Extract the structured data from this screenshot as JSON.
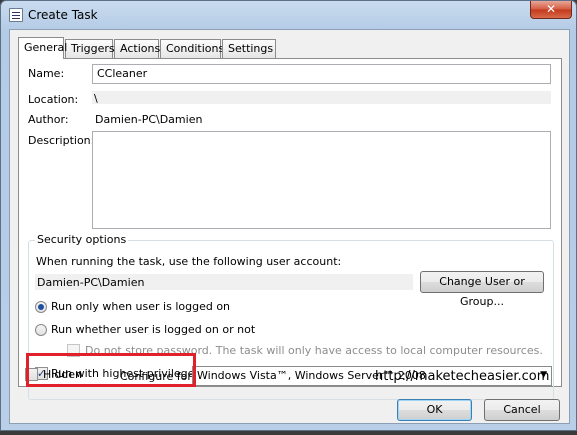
{
  "window": {
    "title": "Create Task",
    "close_glyph": "✕"
  },
  "tabs": [
    {
      "label": "General",
      "active": true
    },
    {
      "label": "Triggers"
    },
    {
      "label": "Actions"
    },
    {
      "label": "Conditions"
    },
    {
      "label": "Settings"
    }
  ],
  "general": {
    "name_label": "Name:",
    "name_value": "CCleaner",
    "location_label": "Location:",
    "location_value": "\\",
    "author_label": "Author:",
    "author_value": "Damien-PC\\Damien",
    "description_label": "Description:",
    "description_value": ""
  },
  "security": {
    "group_title": "Security options",
    "account_prompt": "When running the task, use the following user account:",
    "account_value": "Damien-PC\\Damien",
    "change_user_button": "Change User or Group...",
    "radio_logged_on": "Run only when user is logged on",
    "radio_logged_on_checked": true,
    "radio_whether": "Run whether user is logged on or not",
    "radio_whether_checked": false,
    "no_store_password": "Do not store password.  The task will only have access to local computer resources.",
    "highest_privileges": "Run with highest privileges",
    "highest_privileges_checked": true
  },
  "watermark": "http://maketecheasier.com",
  "bottom": {
    "hidden_label": "Hidden",
    "hidden_checked": false,
    "configure_label": "Configure for:",
    "configure_value": "Windows Vista™, Windows Server™ 2008",
    "ok_button": "OK",
    "cancel_button": "Cancel"
  },
  "colors": {
    "highlight": "#e0202a"
  }
}
